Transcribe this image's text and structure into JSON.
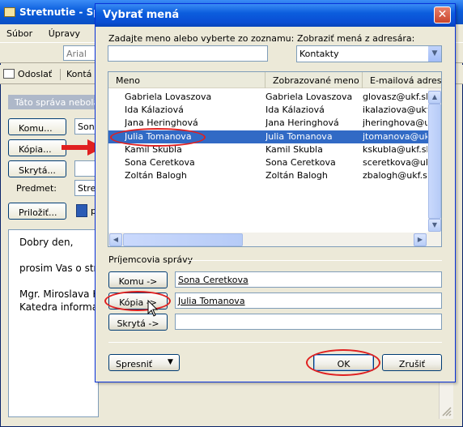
{
  "message_window": {
    "title": "Stretnutie - Sp",
    "menu": [
      "Súbor",
      "Úpravy"
    ],
    "font_box": "Arial",
    "send_label": "Odoslať",
    "contacts_label": "Kontá",
    "info_bar": "Táto správa nebola",
    "to_button": "Komu...",
    "to_value": "Sona",
    "cc_button": "Kópia...",
    "bcc_button": "Skrytá...",
    "subject_label": "Predmet:",
    "subject_value": "Stre",
    "attach_button": "Priložiť...",
    "attach_value": "p",
    "body": [
      "Dobry den,",
      "prosim Vas o str",
      "Mgr. Miroslava K",
      "Katedra informat"
    ]
  },
  "dialog": {
    "title": "Vybrať mená",
    "close_glyph": "✕",
    "search_label": "Zadajte meno alebo vyberte zo zoznamu:",
    "search_value": "",
    "address_book_label": "Zobraziť mená z adresára:",
    "address_book_value": "Kontakty",
    "columns": [
      "Meno",
      "Zobrazované meno",
      "E-mailová adresa"
    ],
    "contacts": [
      {
        "name": "Gabriela Lovaszova",
        "display": "Gabriela Lovaszova",
        "email": "glovasz@ukf.sk"
      },
      {
        "name": "Ida Kálaziová",
        "display": "Ida Kálaziová",
        "email": "ikalaziova@ukf.s"
      },
      {
        "name": "Jana Heringhová",
        "display": "Jana Heringhová",
        "email": "jheringhova@ukf"
      },
      {
        "name": "Julia Tomanova",
        "display": "Julia Tomanova",
        "email": "jtomanova@ukf.s"
      },
      {
        "name": "Kamil Skubla",
        "display": "Kamil Skubla",
        "email": "kskubla@ukf.sk"
      },
      {
        "name": "Sona Ceretkova",
        "display": "Sona Ceretkova",
        "email": "sceretkova@ukf.s"
      },
      {
        "name": "Zoltán Balogh",
        "display": "Zoltán Balogh",
        "email": "zbalogh@ukf.sk"
      }
    ],
    "selected_index": 3,
    "recipients_label": "Príjemcovia správy",
    "to_button": "Komu ->",
    "to_value": "Sona Ceretkova",
    "cc_button": "Kópia ->",
    "cc_value": "Julia Tomanova",
    "bcc_button": "Skrytá ->",
    "bcc_value": "",
    "advanced_button": "Spresniť",
    "ok_button": "OK",
    "cancel_button": "Zrušiť"
  },
  "colors": {
    "selection": "#316ac5",
    "annotation": "#e02020",
    "titlebar": "#0a5ddc"
  }
}
